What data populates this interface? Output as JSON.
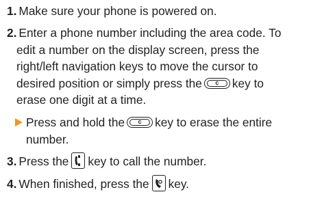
{
  "steps": [
    {
      "num": "1.",
      "text": "Make sure your phone is powered on."
    },
    {
      "num": "2.",
      "lines": [
        "Enter a phone number including the area code. To",
        "edit a number on the display screen, press the",
        "right/left navigation keys to move the cursor to",
        "desired position or simply press the",
        "key to",
        "erase one digit at a time."
      ]
    },
    {
      "bullet": [
        "Press and hold the",
        "key to erase the entire",
        "number."
      ]
    },
    {
      "num": "3.",
      "before": "Press the",
      "after": "key to call the number."
    },
    {
      "num": "4.",
      "before": "When finished, press the",
      "after": "key."
    }
  ],
  "keys": {
    "clear_key": "c",
    "send_key": "send-icon",
    "end_key": "end-icon"
  },
  "colors": {
    "text": "#231f20",
    "bullet_arrow": "#f7931e"
  }
}
